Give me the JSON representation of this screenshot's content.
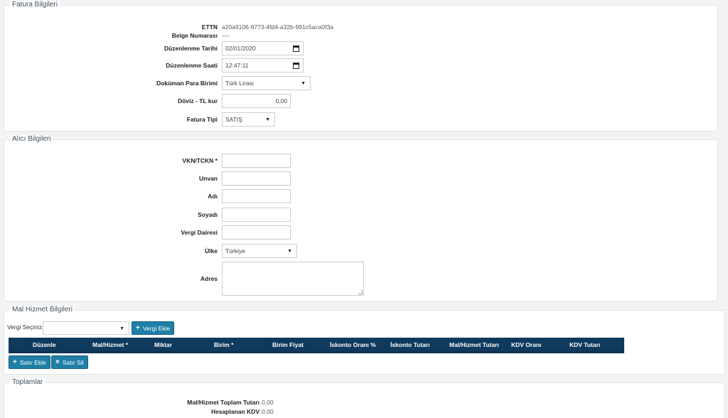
{
  "fatura": {
    "legend": "Fatura Bilgileri",
    "ettn_label": "ETTN",
    "ettn_value": "a20a9106-9773-4fd4-a32b-991c5aca0f3a",
    "belge_label": "Belge Numarası",
    "belge_value": "----",
    "tarih_label": "Düzenlenme Tarihi",
    "tarih_value": "02/01/2020",
    "saat_label": "Düzenlenme Saati",
    "saat_value": "12:47:11",
    "para_label": "Doküman Para Birimi",
    "para_value": "Türk Lirası",
    "kur_label": "Döviz - TL kur",
    "kur_value": "0,00",
    "tip_label": "Fatura Tipi",
    "tip_value": "SATIŞ"
  },
  "alici": {
    "legend": "Alıcı Bilgileri",
    "vkn_label": "VKN/TCKN *",
    "unvan_label": "Unvan",
    "adi_label": "Adı",
    "soyadi_label": "Soyadı",
    "vergi_label": "Vergi Dairesi",
    "ulke_label": "Ülke",
    "ulke_value": "Türkiye",
    "adres_label": "Adres"
  },
  "mal": {
    "legend": "Mal Hizmet Bilgileri",
    "vergi_secin_label": "Vergi Seçiniz:",
    "vergi_ekle": "Vergi Ekle",
    "columns": [
      "Düzenle",
      "Mal/Hizmet *",
      "Miktar",
      "Birim *",
      "Birim Fiyat",
      "İskonto Oranı %",
      "İskonto Tutarı",
      "Mal/Hizmet Tutarı",
      "KDV Oranı",
      "KDV Tutarı"
    ],
    "satir_ekle": "Satır Ekle",
    "satir_sil": "Satır Sil"
  },
  "toplamlar": {
    "legend": "Toplamlar",
    "toplam_label": "Mal/Hizmet Toplam Tutarı",
    "toplam_value": "0,00",
    "kdv_label": "Hesaplanan KDV",
    "kdv_value": "0,00"
  },
  "icons": {
    "calendar": "calendar-icon",
    "dropdown": "chevron-down-icon",
    "plus": "plus-icon",
    "close": "close-icon"
  }
}
